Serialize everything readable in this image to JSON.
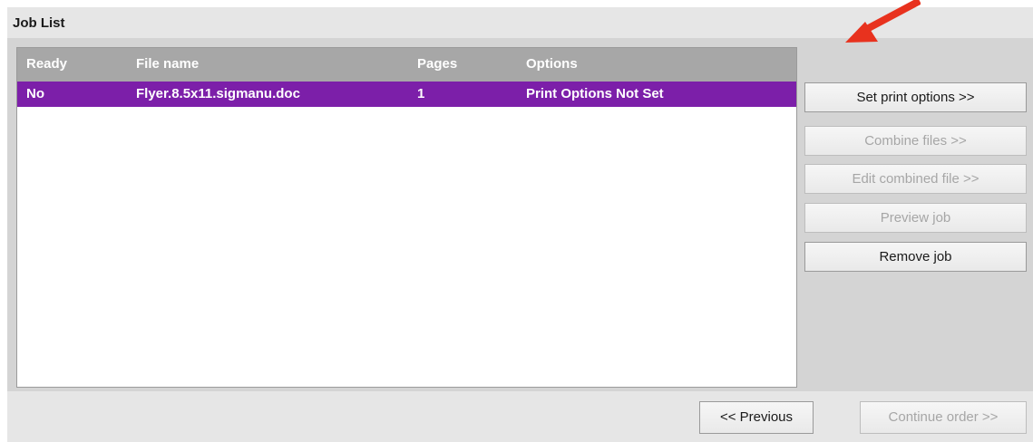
{
  "section_title": "Job List",
  "table": {
    "headers": [
      "Ready",
      "File name",
      "Pages",
      "Options"
    ],
    "rows": [
      {
        "ready": "No",
        "file_name": "Flyer.8.5x11.sigmanu.doc",
        "pages": "1",
        "options": "Print Options Not Set"
      }
    ]
  },
  "side_buttons": {
    "set_print_options": "Set print options >>",
    "combine_files": "Combine files >>",
    "edit_combined_file": "Edit combined file >>",
    "preview_job": "Preview job",
    "remove_job": "Remove job"
  },
  "bottom_buttons": {
    "previous": "<< Previous",
    "continue_order": "Continue order >>"
  },
  "colors": {
    "selected_row": "#7c1fa9",
    "header_bg": "#a7a7a7",
    "annotation_arrow": "#e8321e"
  }
}
